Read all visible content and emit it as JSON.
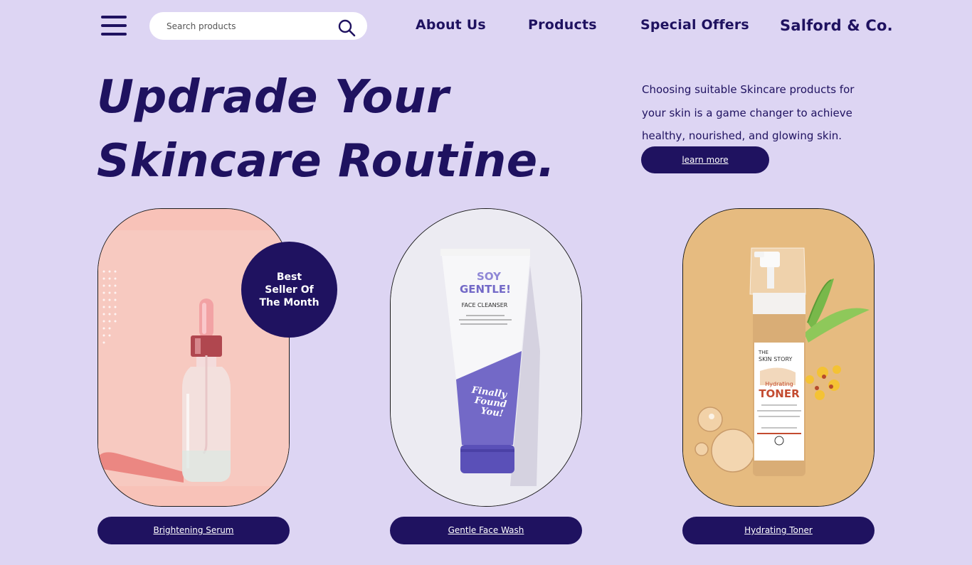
{
  "nav": {
    "search_placeholder": "Search products",
    "links": [
      "About Us",
      "Products",
      "Special Offers"
    ],
    "brand": "Salford & Co."
  },
  "hero": {
    "title_line1": "Updrade Your",
    "title_line2": "Skincare Routine.",
    "description": "Choosing suitable Skincare products for your skin is a game changer to achieve healthy, nourished, and glowing skin.",
    "cta": "learn more"
  },
  "badge": {
    "line1": "Best",
    "line2": "Seller Of",
    "line3": "The Month"
  },
  "products": [
    {
      "name": "Brightening Serum",
      "image": "serum-dropper-bottle"
    },
    {
      "name": "Gentle Face Wash",
      "image": "face-cleanser-tube",
      "label_brand": "SOY",
      "label_title": "GENTLE!",
      "label_sub": "FACE CLEANSER",
      "label_tagline_1": "Finally",
      "label_tagline_2": "Found",
      "label_tagline_3": "You!"
    },
    {
      "name": "Hydrating Toner",
      "image": "toner-pump-bottle",
      "label_brand_1": "THE",
      "label_brand_2": "SKIN STORY",
      "label_sub": "Hydrating",
      "label_title": "TONER"
    }
  ],
  "colors": {
    "background": "#ddd5f3",
    "primary": "#1f1260",
    "card_serum": "#f8c2b8",
    "card_wash": "#ecebf2",
    "card_toner": "#e6bb80"
  }
}
